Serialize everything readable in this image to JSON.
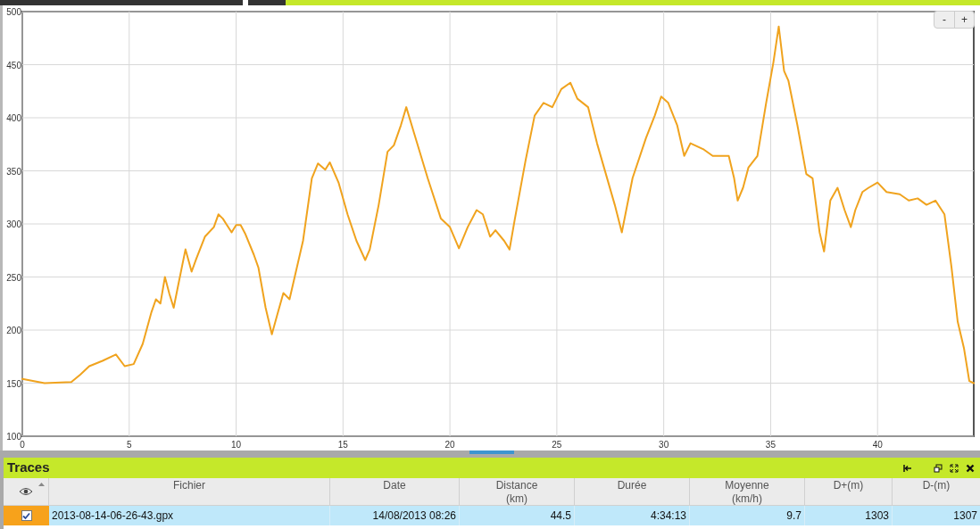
{
  "chart": {
    "zoom_controls": [
      "-",
      "+"
    ],
    "chart_data": {
      "type": "line",
      "grid": true,
      "xlim": [
        0,
        44.5
      ],
      "ylim": [
        100,
        500
      ],
      "xticks": [
        0,
        5,
        10,
        15,
        20,
        25,
        30,
        35,
        40
      ],
      "yticks": [
        100,
        150,
        200,
        250,
        300,
        350,
        400,
        450,
        500
      ],
      "x": [
        0,
        1.04,
        2.29,
        2.71,
        3.13,
        3.75,
        4.38,
        4.79,
        5.21,
        5.63,
        6.04,
        6.25,
        6.46,
        6.67,
        6.88,
        7.08,
        7.29,
        7.63,
        7.92,
        8.13,
        8.54,
        8.96,
        9.17,
        9.38,
        9.79,
        10,
        10.21,
        10.42,
        10.83,
        11.04,
        11.38,
        11.67,
        11.96,
        12.21,
        12.5,
        13.13,
        13.54,
        13.83,
        14.17,
        14.38,
        14.79,
        15.21,
        15.63,
        16.04,
        16.25,
        16.67,
        17.08,
        17.38,
        17.71,
        17.96,
        18.33,
        18.96,
        19.58,
        20,
        20.42,
        20.83,
        21.25,
        21.54,
        21.88,
        22.13,
        22.54,
        22.79,
        23.04,
        23.54,
        23.96,
        24.38,
        24.79,
        25.21,
        25.63,
        25.96,
        26.46,
        26.88,
        27.71,
        28.04,
        28.54,
        29.17,
        29.58,
        29.88,
        30.21,
        30.63,
        30.96,
        31.25,
        31.88,
        32.29,
        32.71,
        33.04,
        33.29,
        33.46,
        33.71,
        33.96,
        34.38,
        34.79,
        35.13,
        35.38,
        35.63,
        35.83,
        36.25,
        36.67,
        36.96,
        37.29,
        37.5,
        37.79,
        38.13,
        38.46,
        38.75,
        38.96,
        39.29,
        39.58,
        40,
        40.42,
        41.04,
        41.46,
        41.88,
        42.29,
        42.71,
        43.13,
        43.46,
        43.75,
        44.04,
        44.29,
        44.5
      ],
      "series": [
        {
          "color": "#f0a31e",
          "values": [
            154,
            150,
            151,
            158,
            166,
            171,
            177,
            166,
            168,
            187,
            217,
            229,
            225,
            250,
            234,
            221,
            242,
            276,
            255,
            267,
            288,
            297,
            309,
            305,
            292,
            299,
            299,
            291,
            271,
            259,
            221,
            196,
            217,
            235,
            229,
            284,
            343,
            357,
            351,
            358,
            339,
            309,
            284,
            266,
            276,
            318,
            368,
            374,
            393,
            410,
            385,
            343,
            305,
            297,
            277,
            297,
            313,
            309,
            288,
            294,
            284,
            276,
            305,
            360,
            402,
            414,
            410,
            427,
            433,
            418,
            410,
            376,
            318,
            292,
            343,
            381,
            402,
            420,
            414,
            393,
            364,
            376,
            370,
            364,
            364,
            364,
            343,
            322,
            334,
            353,
            364,
            414,
            452,
            486,
            444,
            435,
            393,
            347,
            343,
            292,
            274,
            322,
            334,
            313,
            297,
            313,
            330,
            334,
            339,
            330,
            328,
            322,
            324,
            318,
            322,
            309,
            259,
            208,
            183,
            152,
            150
          ]
        }
      ]
    }
  },
  "traces": {
    "title": "Traces",
    "columns": [
      {
        "lines": [
          "Fichier"
        ]
      },
      {
        "lines": [
          "Date"
        ]
      },
      {
        "lines": [
          "Distance",
          "(km)"
        ]
      },
      {
        "lines": [
          "Durée"
        ]
      },
      {
        "lines": [
          "Moyenne",
          "(km/h)"
        ]
      },
      {
        "lines": [
          "D+(m)"
        ]
      },
      {
        "lines": [
          "D-(m)"
        ]
      }
    ],
    "rows": [
      {
        "checked": true,
        "selected": true,
        "cells": [
          "2013-08-14-06-26-43.gpx",
          "14/08/2013 08:26",
          "44.5",
          "4:34:13",
          "9.7",
          "1303",
          "1307"
        ]
      }
    ]
  }
}
